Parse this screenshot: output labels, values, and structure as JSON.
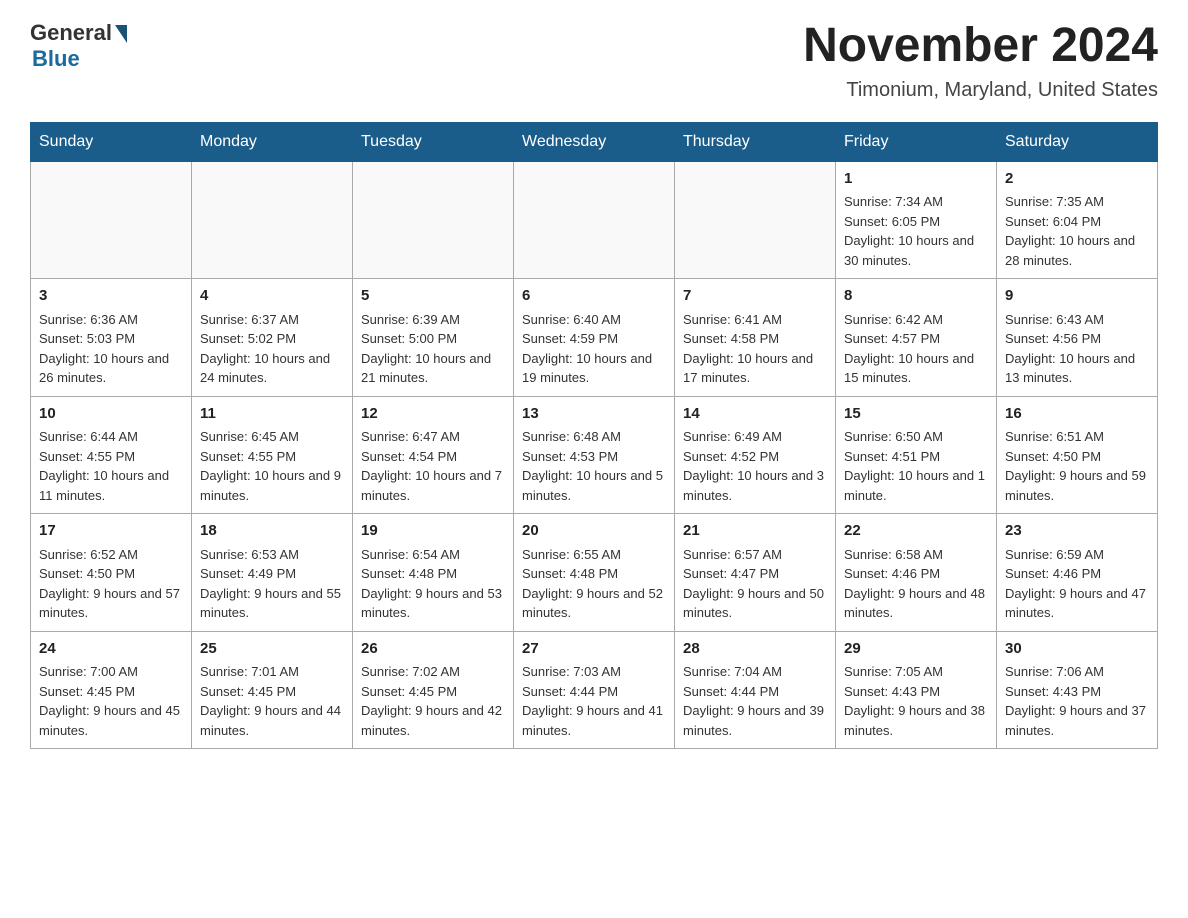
{
  "logo": {
    "general": "General",
    "blue": "Blue"
  },
  "title": "November 2024",
  "subtitle": "Timonium, Maryland, United States",
  "days": [
    "Sunday",
    "Monday",
    "Tuesday",
    "Wednesday",
    "Thursday",
    "Friday",
    "Saturday"
  ],
  "weeks": [
    [
      {
        "day": "",
        "sunrise": "",
        "sunset": "",
        "daylight": ""
      },
      {
        "day": "",
        "sunrise": "",
        "sunset": "",
        "daylight": ""
      },
      {
        "day": "",
        "sunrise": "",
        "sunset": "",
        "daylight": ""
      },
      {
        "day": "",
        "sunrise": "",
        "sunset": "",
        "daylight": ""
      },
      {
        "day": "",
        "sunrise": "",
        "sunset": "",
        "daylight": ""
      },
      {
        "day": "1",
        "sunrise": "Sunrise: 7:34 AM",
        "sunset": "Sunset: 6:05 PM",
        "daylight": "Daylight: 10 hours and 30 minutes."
      },
      {
        "day": "2",
        "sunrise": "Sunrise: 7:35 AM",
        "sunset": "Sunset: 6:04 PM",
        "daylight": "Daylight: 10 hours and 28 minutes."
      }
    ],
    [
      {
        "day": "3",
        "sunrise": "Sunrise: 6:36 AM",
        "sunset": "Sunset: 5:03 PM",
        "daylight": "Daylight: 10 hours and 26 minutes."
      },
      {
        "day": "4",
        "sunrise": "Sunrise: 6:37 AM",
        "sunset": "Sunset: 5:02 PM",
        "daylight": "Daylight: 10 hours and 24 minutes."
      },
      {
        "day": "5",
        "sunrise": "Sunrise: 6:39 AM",
        "sunset": "Sunset: 5:00 PM",
        "daylight": "Daylight: 10 hours and 21 minutes."
      },
      {
        "day": "6",
        "sunrise": "Sunrise: 6:40 AM",
        "sunset": "Sunset: 4:59 PM",
        "daylight": "Daylight: 10 hours and 19 minutes."
      },
      {
        "day": "7",
        "sunrise": "Sunrise: 6:41 AM",
        "sunset": "Sunset: 4:58 PM",
        "daylight": "Daylight: 10 hours and 17 minutes."
      },
      {
        "day": "8",
        "sunrise": "Sunrise: 6:42 AM",
        "sunset": "Sunset: 4:57 PM",
        "daylight": "Daylight: 10 hours and 15 minutes."
      },
      {
        "day": "9",
        "sunrise": "Sunrise: 6:43 AM",
        "sunset": "Sunset: 4:56 PM",
        "daylight": "Daylight: 10 hours and 13 minutes."
      }
    ],
    [
      {
        "day": "10",
        "sunrise": "Sunrise: 6:44 AM",
        "sunset": "Sunset: 4:55 PM",
        "daylight": "Daylight: 10 hours and 11 minutes."
      },
      {
        "day": "11",
        "sunrise": "Sunrise: 6:45 AM",
        "sunset": "Sunset: 4:55 PM",
        "daylight": "Daylight: 10 hours and 9 minutes."
      },
      {
        "day": "12",
        "sunrise": "Sunrise: 6:47 AM",
        "sunset": "Sunset: 4:54 PM",
        "daylight": "Daylight: 10 hours and 7 minutes."
      },
      {
        "day": "13",
        "sunrise": "Sunrise: 6:48 AM",
        "sunset": "Sunset: 4:53 PM",
        "daylight": "Daylight: 10 hours and 5 minutes."
      },
      {
        "day": "14",
        "sunrise": "Sunrise: 6:49 AM",
        "sunset": "Sunset: 4:52 PM",
        "daylight": "Daylight: 10 hours and 3 minutes."
      },
      {
        "day": "15",
        "sunrise": "Sunrise: 6:50 AM",
        "sunset": "Sunset: 4:51 PM",
        "daylight": "Daylight: 10 hours and 1 minute."
      },
      {
        "day": "16",
        "sunrise": "Sunrise: 6:51 AM",
        "sunset": "Sunset: 4:50 PM",
        "daylight": "Daylight: 9 hours and 59 minutes."
      }
    ],
    [
      {
        "day": "17",
        "sunrise": "Sunrise: 6:52 AM",
        "sunset": "Sunset: 4:50 PM",
        "daylight": "Daylight: 9 hours and 57 minutes."
      },
      {
        "day": "18",
        "sunrise": "Sunrise: 6:53 AM",
        "sunset": "Sunset: 4:49 PM",
        "daylight": "Daylight: 9 hours and 55 minutes."
      },
      {
        "day": "19",
        "sunrise": "Sunrise: 6:54 AM",
        "sunset": "Sunset: 4:48 PM",
        "daylight": "Daylight: 9 hours and 53 minutes."
      },
      {
        "day": "20",
        "sunrise": "Sunrise: 6:55 AM",
        "sunset": "Sunset: 4:48 PM",
        "daylight": "Daylight: 9 hours and 52 minutes."
      },
      {
        "day": "21",
        "sunrise": "Sunrise: 6:57 AM",
        "sunset": "Sunset: 4:47 PM",
        "daylight": "Daylight: 9 hours and 50 minutes."
      },
      {
        "day": "22",
        "sunrise": "Sunrise: 6:58 AM",
        "sunset": "Sunset: 4:46 PM",
        "daylight": "Daylight: 9 hours and 48 minutes."
      },
      {
        "day": "23",
        "sunrise": "Sunrise: 6:59 AM",
        "sunset": "Sunset: 4:46 PM",
        "daylight": "Daylight: 9 hours and 47 minutes."
      }
    ],
    [
      {
        "day": "24",
        "sunrise": "Sunrise: 7:00 AM",
        "sunset": "Sunset: 4:45 PM",
        "daylight": "Daylight: 9 hours and 45 minutes."
      },
      {
        "day": "25",
        "sunrise": "Sunrise: 7:01 AM",
        "sunset": "Sunset: 4:45 PM",
        "daylight": "Daylight: 9 hours and 44 minutes."
      },
      {
        "day": "26",
        "sunrise": "Sunrise: 7:02 AM",
        "sunset": "Sunset: 4:45 PM",
        "daylight": "Daylight: 9 hours and 42 minutes."
      },
      {
        "day": "27",
        "sunrise": "Sunrise: 7:03 AM",
        "sunset": "Sunset: 4:44 PM",
        "daylight": "Daylight: 9 hours and 41 minutes."
      },
      {
        "day": "28",
        "sunrise": "Sunrise: 7:04 AM",
        "sunset": "Sunset: 4:44 PM",
        "daylight": "Daylight: 9 hours and 39 minutes."
      },
      {
        "day": "29",
        "sunrise": "Sunrise: 7:05 AM",
        "sunset": "Sunset: 4:43 PM",
        "daylight": "Daylight: 9 hours and 38 minutes."
      },
      {
        "day": "30",
        "sunrise": "Sunrise: 7:06 AM",
        "sunset": "Sunset: 4:43 PM",
        "daylight": "Daylight: 9 hours and 37 minutes."
      }
    ]
  ]
}
